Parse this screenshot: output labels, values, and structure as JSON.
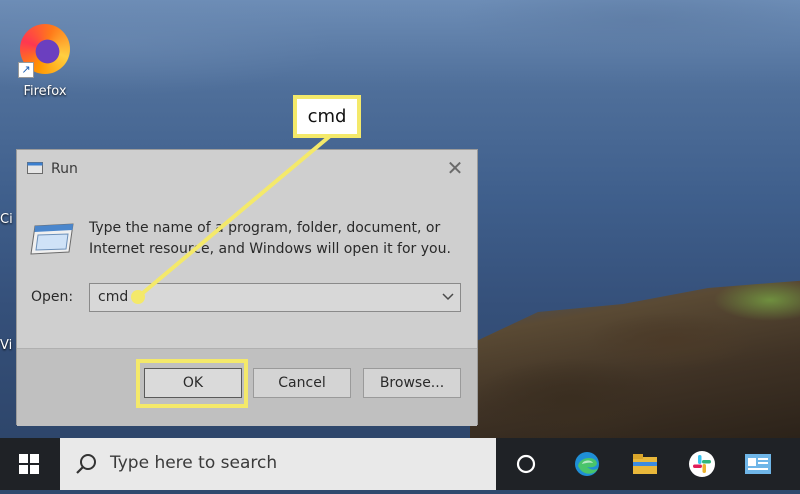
{
  "desktop": {
    "icons": [
      {
        "label": "Firefox",
        "icon": "firefox-icon"
      }
    ],
    "edge_labels": [
      "Ci",
      "Vi"
    ]
  },
  "callout": {
    "text": "cmd"
  },
  "run_dialog": {
    "title": "Run",
    "description": "Type the name of a program, folder, document, or Internet resource, and Windows will open it for you.",
    "open_label": "Open:",
    "open_value": "cmd",
    "buttons": {
      "ok": "OK",
      "cancel": "Cancel",
      "browse": "Browse..."
    }
  },
  "taskbar": {
    "search_placeholder": "Type here to search",
    "pinned": [
      "task-view-icon",
      "edge-icon",
      "file-explorer-icon",
      "slack-icon",
      "app-icon"
    ]
  },
  "colors": {
    "highlight": "#f4e96a",
    "taskbar": "#1f2226"
  }
}
